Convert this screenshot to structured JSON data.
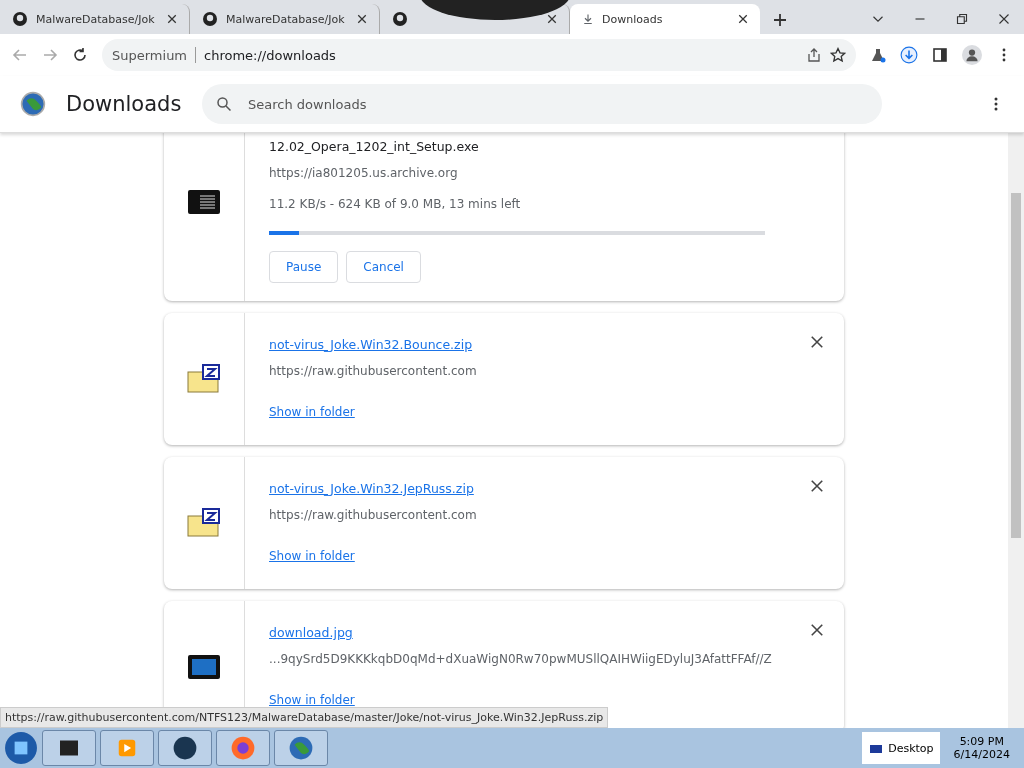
{
  "tabs": [
    {
      "title": "MalwareDatabase/Jok",
      "selected": false
    },
    {
      "title": "MalwareDatabase/Jok",
      "selected": false
    },
    {
      "selected": false
    },
    {
      "title": "Downloads",
      "selected": true
    }
  ],
  "address": {
    "site": "Supermium",
    "scheme": "chrome://",
    "path": "downloads"
  },
  "page": {
    "title": "Downloads",
    "search": {
      "placeholder": "Search downloads"
    }
  },
  "downloads": [
    {
      "kind": "active",
      "name": "12.02_Opera_1202_int_Setup.exe",
      "source": "https://ia801205.us.archive.org",
      "status": "11.2 KB/s - 624 KB of 9.0 MB, 13 mins left",
      "level": 0.06,
      "buttons": [
        "Pause",
        "Cancel"
      ]
    },
    {
      "kind": "archive",
      "name": "not-virus_Joke.Win32.Bounce.zip",
      "source": "https://raw.githubusercontent.com",
      "link": "Show in folder"
    },
    {
      "kind": "archive",
      "name": "not-virus_Joke.Win32.JepRuss.zip",
      "source": "https://raw.githubusercontent.com",
      "link": "Show in folder"
    },
    {
      "kind": "image",
      "name": "download.jpg",
      "source": "...9qySrd5D9KKKkqbD0qMd+dXuaWigN0Rw70pwMUSllQAIHWiigEDyluJ3AfattFFAf//Z",
      "link": "Show in folder"
    }
  ],
  "status_bubble": "https://raw.githubusercontent.com/NTFS123/MalwareDatabase/master/Joke/not-virus_Joke.Win32.JepRuss.zip",
  "taskbar": {
    "tray_label": "Desktop",
    "time": "5:09 PM",
    "date": "6/14/2024"
  }
}
